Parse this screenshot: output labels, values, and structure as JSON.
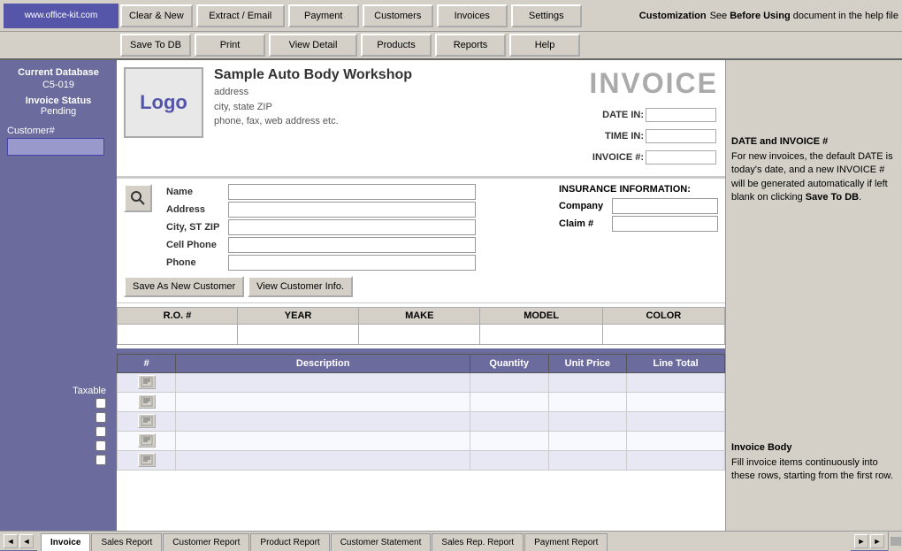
{
  "site": {
    "url": "www.office-kit.com"
  },
  "toolbar": {
    "row1": {
      "btn1": "Clear & New",
      "btn2": "Extract / Email",
      "btn3": "Payment",
      "btn4": "Customers",
      "btn5": "Invoices",
      "btn6": "Settings"
    },
    "row2": {
      "btn1": "Save To DB",
      "btn2": "Print",
      "btn3": "View Detail",
      "btn4": "Products",
      "btn5": "Reports",
      "btn6": "Help"
    }
  },
  "sidebar": {
    "db_label": "Current Database",
    "db_value": "C5-019",
    "status_label": "Invoice Status",
    "status_value": "Pending",
    "customer_label": "Customer#",
    "taxable_label": "Taxable"
  },
  "help_panel": {
    "section1_title": "Customization",
    "section1_text": "See Before Using document in the help file",
    "section2_title": "DATE and INVOICE #",
    "section2_text": "For new invoices, the default DATE is today's date, and a new INVOICE # will be generated automatically if left blank  on clicking Save To DB.",
    "section3_title": "Invoice Body",
    "section3_text": "Fill invoice items continuously into these rows, starting from the first row."
  },
  "invoice": {
    "title": "INVOICE",
    "logo_text": "Logo",
    "company_name": "Sample Auto Body Workshop",
    "address": "address",
    "city_state": "city, state ZIP",
    "phone": "phone, fax, web address etc.",
    "date_in_label": "DATE IN:",
    "time_in_label": "TIME IN:",
    "invoice_num_label": "INVOICE #:",
    "date_in_value": "",
    "time_in_value": "",
    "invoice_num_value": ""
  },
  "customer": {
    "name_label": "Name",
    "address_label": "Address",
    "city_label": "City, ST ZIP",
    "cell_label": "Cell Phone",
    "phone_label": "Phone",
    "company_label": "Company",
    "claim_label": "Claim #",
    "insurance_title": "INSURANCE INFORMATION:",
    "btn_save": "Save As New Customer",
    "btn_view": "View Customer Info."
  },
  "vehicle_table": {
    "headers": [
      "R.O. #",
      "YEAR",
      "MAKE",
      "MODEL",
      "COLOR"
    ],
    "rows": [
      [
        "",
        "",
        "",
        "",
        ""
      ]
    ]
  },
  "items_table": {
    "headers": [
      "#",
      "Description",
      "Quantity",
      "Unit Price",
      "Line Total"
    ],
    "rows": [
      {
        "num": "",
        "desc": "",
        "qty": "",
        "price": "",
        "total": ""
      },
      {
        "num": "",
        "desc": "",
        "qty": "",
        "price": "",
        "total": ""
      },
      {
        "num": "",
        "desc": "",
        "qty": "",
        "price": "",
        "total": ""
      },
      {
        "num": "",
        "desc": "",
        "qty": "",
        "price": "",
        "total": ""
      },
      {
        "num": "",
        "desc": "",
        "qty": "",
        "price": "",
        "total": ""
      }
    ]
  },
  "tabs": [
    {
      "label": "Invoice",
      "active": true
    },
    {
      "label": "Sales Report",
      "active": false
    },
    {
      "label": "Customer Report",
      "active": false
    },
    {
      "label": "Product Report",
      "active": false
    },
    {
      "label": "Customer Statement",
      "active": false
    },
    {
      "label": "Sales Rep. Report",
      "active": false
    },
    {
      "label": "Payment Report",
      "active": false
    }
  ]
}
